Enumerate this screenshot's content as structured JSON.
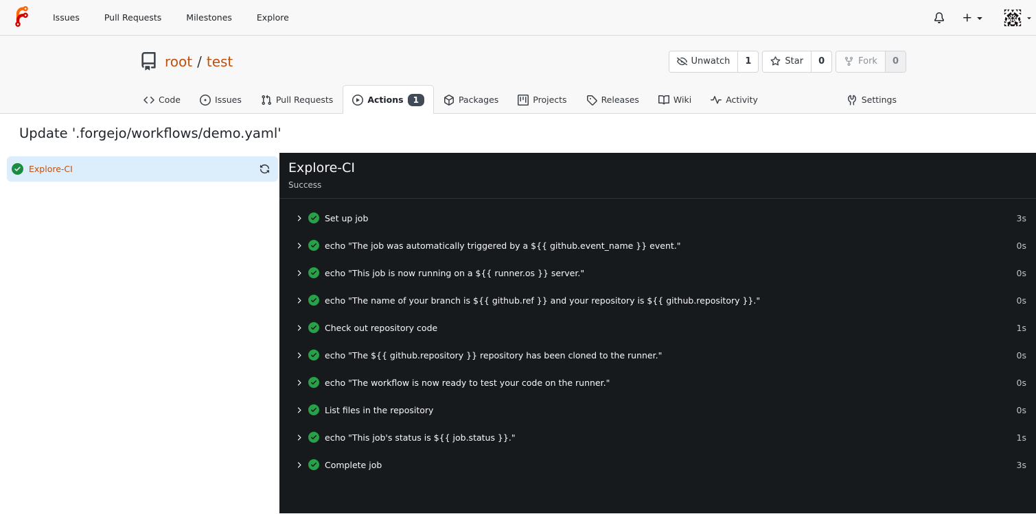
{
  "navbar": {
    "logo": "forgejo-logo",
    "items": [
      {
        "label": "Issues"
      },
      {
        "label": "Pull Requests"
      },
      {
        "label": "Milestones"
      },
      {
        "label": "Explore"
      }
    ],
    "right": {
      "notifications_icon": "bell-icon",
      "create_icon": "plus-icon",
      "avatar_icon": "user-avatar-identicon"
    }
  },
  "repo": {
    "icon": "repo-icon",
    "owner": "root",
    "separator": "/",
    "name": "test",
    "actions": [
      {
        "label": "Unwatch",
        "count": "1",
        "icon": "eye-closed-icon",
        "disabled": false
      },
      {
        "label": "Star",
        "count": "0",
        "icon": "star-icon",
        "disabled": false
      },
      {
        "label": "Fork",
        "count": "0",
        "icon": "fork-icon",
        "disabled": true
      }
    ]
  },
  "tabs": [
    {
      "label": "Code",
      "icon": "code-icon",
      "active": false
    },
    {
      "label": "Issues",
      "icon": "issue-opened-icon",
      "active": false
    },
    {
      "label": "Pull Requests",
      "icon": "git-pull-request-icon",
      "active": false
    },
    {
      "label": "Actions",
      "icon": "play-icon",
      "active": true,
      "badge": "1"
    },
    {
      "label": "Packages",
      "icon": "package-icon",
      "active": false
    },
    {
      "label": "Projects",
      "icon": "project-icon",
      "active": false
    },
    {
      "label": "Releases",
      "icon": "tag-icon",
      "active": false
    },
    {
      "label": "Wiki",
      "icon": "book-icon",
      "active": false
    },
    {
      "label": "Activity",
      "icon": "pulse-icon",
      "active": false
    },
    {
      "label": "Settings",
      "icon": "tools-icon",
      "active": false,
      "right": true
    }
  ],
  "run": {
    "title": "Update '.forgejo/workflows/demo.yaml'"
  },
  "jobs": [
    {
      "name": "Explore-CI",
      "status": "success",
      "status_icon": "check-circle-icon",
      "rerun_icon": "sync-icon"
    }
  ],
  "log": {
    "job_title": "Explore-CI",
    "job_status": "Success",
    "steps": [
      {
        "name": "Set up job",
        "duration": "3s"
      },
      {
        "name": "echo \"The job was automatically triggered by a ${{ github.event_name }} event.\"",
        "duration": "0s"
      },
      {
        "name": "echo \"This job is now running on a ${{ runner.os }} server.\"",
        "duration": "0s"
      },
      {
        "name": "echo \"The name of your branch is ${{ github.ref }} and your repository is ${{ github.repository }}.\"",
        "duration": "0s"
      },
      {
        "name": "Check out repository code",
        "duration": "1s"
      },
      {
        "name": "echo \"The ${{ github.repository }} repository has been cloned to the runner.\"",
        "duration": "0s"
      },
      {
        "name": "echo \"The workflow is now ready to test your code on the runner.\"",
        "duration": "0s"
      },
      {
        "name": "List files in the repository",
        "duration": "0s"
      },
      {
        "name": "echo \"This job's status is ${{ job.status }}.\"",
        "duration": "1s"
      },
      {
        "name": "Complete job",
        "duration": "3s"
      }
    ]
  },
  "colors": {
    "primary_orange": "#c24f0e",
    "frame_bg": "#f8f8f8",
    "console_bg": "#171a1d",
    "console_fg": "#f8f8f9",
    "console_fg_subtle": "#bec4c8",
    "success_green": "#28a048",
    "job_selected_bg": "#dceefc",
    "badge_bg": "#414b55"
  }
}
